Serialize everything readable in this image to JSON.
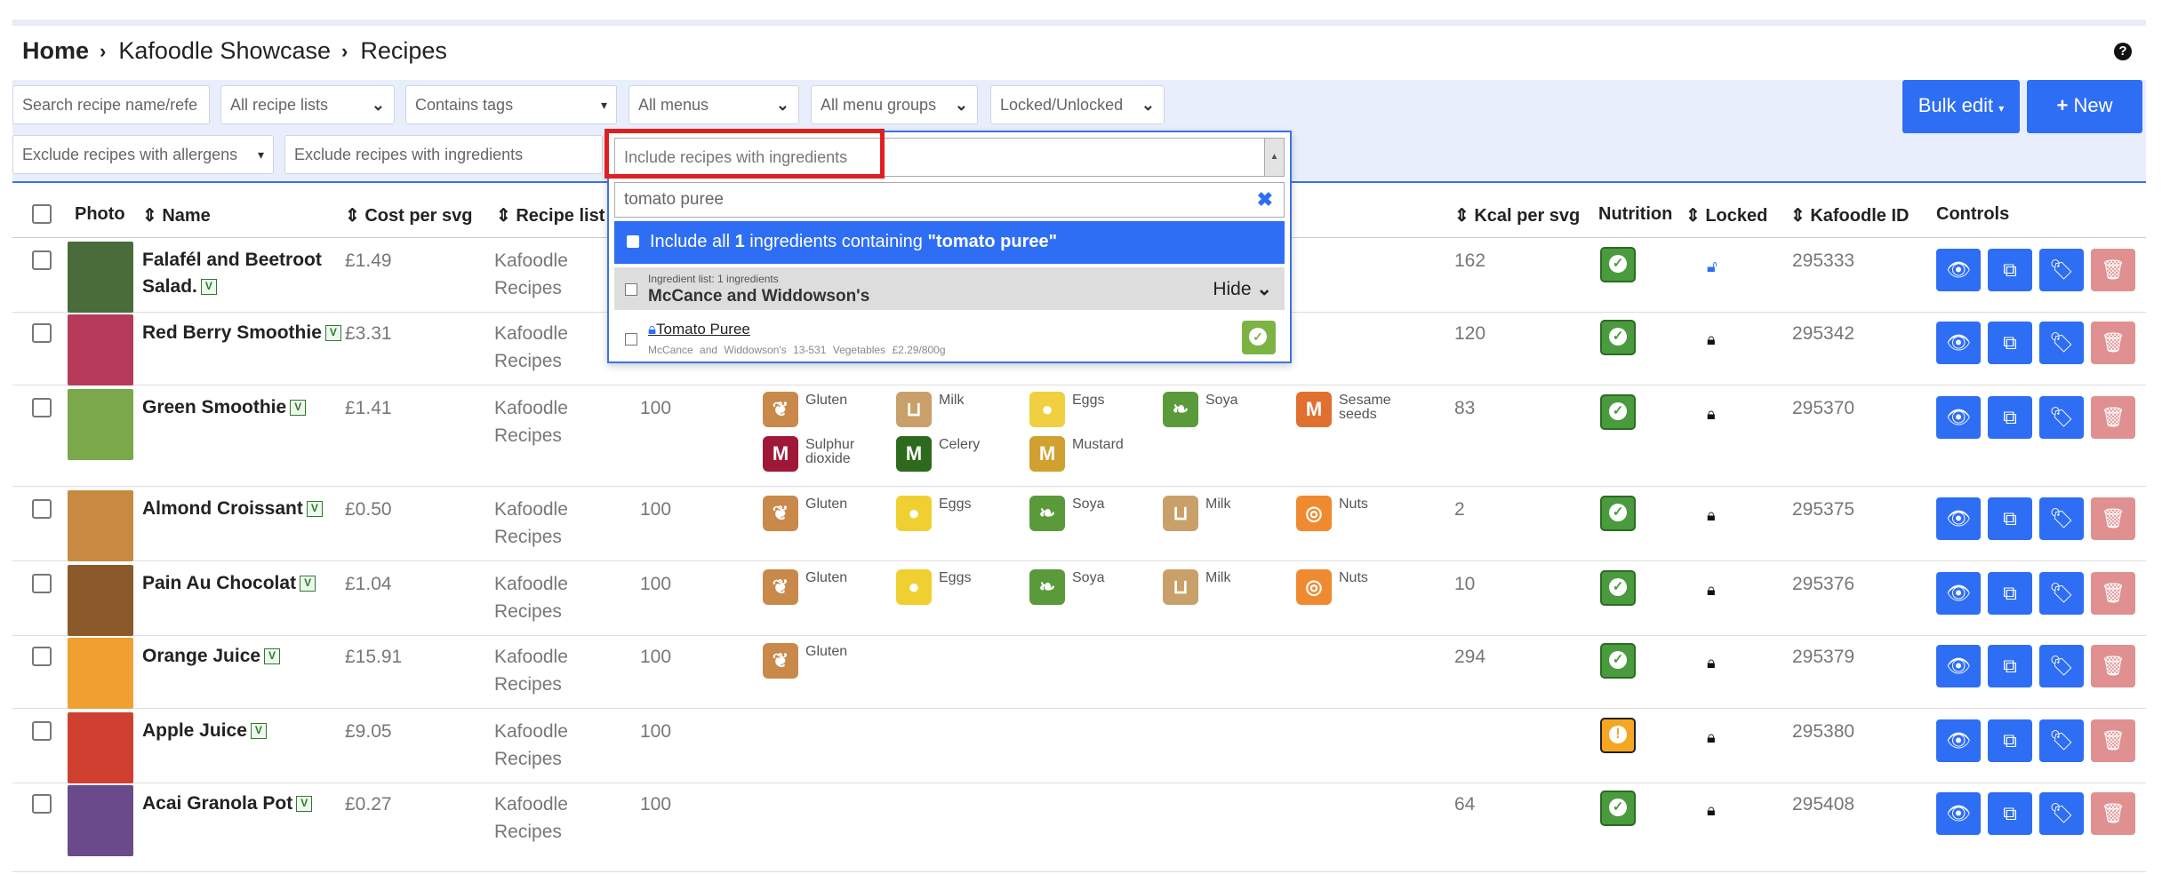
{
  "breadcrumb": {
    "home": "Home",
    "showcase": "Kafoodle Showcase",
    "current": "Recipes"
  },
  "help_icon": "question-circle-icon",
  "filters": {
    "search_placeholder": "Search recipe name/refe",
    "recipe_lists": "All recipe lists",
    "contains_tags": "Contains tags",
    "menus": "All menus",
    "menu_groups": "All menu groups",
    "locked": "Locked/Unlocked",
    "exclude_allergens": "Exclude recipes with allergens",
    "exclude_ingredients": "Exclude recipes with ingredients",
    "include_ingredients": "Include recipes with ingredients"
  },
  "buttons": {
    "bulk_edit": "Bulk edit",
    "new": "New"
  },
  "dropdown": {
    "search_value": "tomato puree",
    "include_all_prefix": "Include all ",
    "include_all_count": "1",
    "include_all_mid": " ingredients containing ",
    "include_all_term": "\"tomato puree\"",
    "group_meta": "Ingredient list: 1 ingredients",
    "group_name": "McCance and Widdowson's",
    "hide_label": "Hide",
    "item_name": "Tomato Puree",
    "item_meta": "McCance and Widdowson's  13-531  Vegetables  £2.29/800g"
  },
  "columns": {
    "photo": "Photo",
    "name": "Name",
    "cost": "Cost per svg",
    "recipe_list": "Recipe list",
    "kcal": "Kcal per svg",
    "nutrition": "Nutrition",
    "locked": "Locked",
    "kid": "Kafoodle ID",
    "controls": "Controls"
  },
  "rows": [
    {
      "name1": "Falafél and Beetroot",
      "name2": "Salad.",
      "cost": "£1.49",
      "list1": "Kafoodle",
      "list2": "Recipes",
      "portions": "",
      "kcal": "162",
      "id": "295333",
      "nutrition": "ok",
      "locked": false,
      "photo_color": "#4a6b3a"
    },
    {
      "name1": "Red Berry Smoothie",
      "name2": "",
      "cost": "£3.31",
      "list1": "Kafoodle",
      "list2": "Recipes",
      "portions": "",
      "kcal": "120",
      "id": "295342",
      "nutrition": "ok",
      "locked": true,
      "photo_color": "#b83a5a"
    },
    {
      "name1": "Green Smoothie",
      "name2": "",
      "cost": "£1.41",
      "list1": "Kafoodle",
      "list2": "Recipes",
      "portions": "100",
      "kcal": "83",
      "id": "295370",
      "nutrition": "ok",
      "locked": true,
      "photo_color": "#7aa84a"
    },
    {
      "name1": "Almond Croissant",
      "name2": "",
      "cost": "£0.50",
      "list1": "Kafoodle",
      "list2": "Recipes",
      "portions": "100",
      "kcal": "2",
      "id": "295375",
      "nutrition": "ok",
      "locked": true,
      "photo_color": "#c88a40"
    },
    {
      "name1": "Pain Au Chocolat",
      "name2": "",
      "cost": "£1.04",
      "list1": "Kafoodle",
      "list2": "Recipes",
      "portions": "100",
      "kcal": "10",
      "id": "295376",
      "nutrition": "ok",
      "locked": true,
      "photo_color": "#8a5a2a"
    },
    {
      "name1": "Orange Juice",
      "name2": "",
      "cost": "£15.91",
      "list1": "Kafoodle",
      "list2": "Recipes",
      "portions": "100",
      "kcal": "294",
      "id": "295379",
      "nutrition": "ok",
      "locked": true,
      "photo_color": "#f0a030"
    },
    {
      "name1": "Apple Juice",
      "name2": "",
      "cost": "£9.05",
      "list1": "Kafoodle",
      "list2": "Recipes",
      "portions": "100",
      "kcal": "",
      "id": "295380",
      "nutrition": "warn",
      "locked": true,
      "photo_color": "#d04030"
    },
    {
      "name1": "Acai Granola Pot",
      "name2": "",
      "cost": "£0.27",
      "list1": "Kafoodle",
      "list2": "Recipes",
      "portions": "100",
      "kcal": "64",
      "id": "295408",
      "nutrition": "ok",
      "locked": true,
      "photo_color": "#6a4a8a"
    }
  ],
  "allergens": {
    "gluten": "Gluten",
    "milk": "Milk",
    "eggs": "Eggs",
    "soya": "Soya",
    "sesame1": "Sesame",
    "sesame2": "seeds",
    "sulphur1": "Sulphur",
    "sulphur2": "dioxide",
    "celery": "Celery",
    "mustard": "Mustard",
    "nuts": "Nuts"
  },
  "colors": {
    "primary": "#2e6ef5",
    "delete": "#e09090",
    "highlight": "#e02020",
    "nutrition_ok": "#4a9b3e",
    "nutrition_warn": "#f5a623"
  }
}
